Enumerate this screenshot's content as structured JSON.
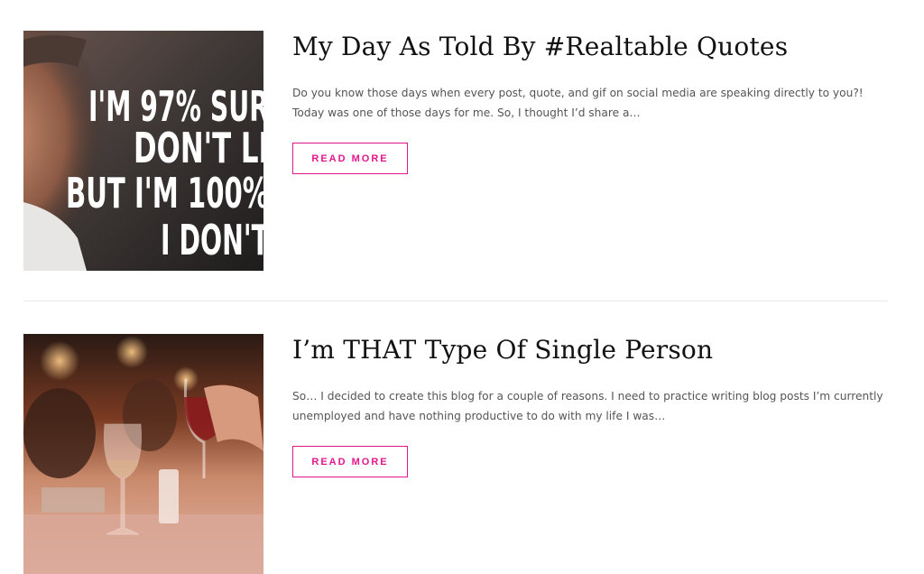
{
  "posts": [
    {
      "title": "My Day As Told By #Realtable Quotes",
      "excerpt": "Do you know those days when every post, quote, and gif on social media are speaking directly to you?! Today was one of those days for me. So, I thought I’d share a…",
      "read_more": "READ MORE",
      "thumbnail": {
        "lines": [
          "I'M 97% SUR",
          "DON'T LI",
          "BUT I'M 100%",
          "I DON'T"
        ]
      }
    },
    {
      "title": "I’m THAT Type Of Single Person",
      "excerpt": "So… I decided to create this blog for a couple of reasons. I need to practice writing blog posts I’m currently unemployed and have nothing productive to do with my life I was…",
      "read_more": "READ MORE",
      "thumbnail": {}
    }
  ],
  "colors": {
    "accent": "#e4168d",
    "title": "#111111",
    "text": "#555555",
    "divider": "#ececec"
  }
}
